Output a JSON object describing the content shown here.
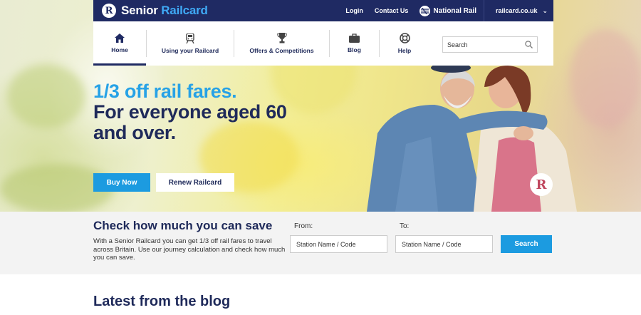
{
  "brand": {
    "badge": "R",
    "name_part1": "Senior",
    "name_part2": "Railcard"
  },
  "header": {
    "links": [
      "Login",
      "Contact Us"
    ],
    "national_rail": "National Rail",
    "site_selector": "railcard.co.uk"
  },
  "nav": {
    "items": [
      {
        "label": "Home",
        "icon": "home-icon",
        "active": true
      },
      {
        "label": "Using your Railcard",
        "icon": "train-icon",
        "active": false
      },
      {
        "label": "Offers & Competitions",
        "icon": "trophy-icon",
        "active": false
      },
      {
        "label": "Blog",
        "icon": "briefcase-icon",
        "active": false
      },
      {
        "label": "Help",
        "icon": "lifebuoy-icon",
        "active": false
      }
    ],
    "search_placeholder": "Search"
  },
  "hero": {
    "headline_line1": "1/3 off rail fares.",
    "headline_line2": "For everyone aged 60 and over.",
    "buy_label": "Buy Now",
    "renew_label": "Renew Railcard",
    "badge": "R"
  },
  "savings": {
    "title": "Check how much you can save",
    "description": "With a Senior Railcard you can get 1/3 off rail fares to travel across Britain. Use our journey calculation and check how much you can save.",
    "from_label": "From:",
    "to_label": "To:",
    "from_placeholder": "Station Name / Code",
    "to_placeholder": "Station Name / Code",
    "search_label": "Search"
  },
  "blog": {
    "title": "Latest from the blog"
  },
  "colors": {
    "navy": "#1f2a63",
    "accent_blue": "#1c9be0",
    "headline_blue": "#27a2e6"
  }
}
